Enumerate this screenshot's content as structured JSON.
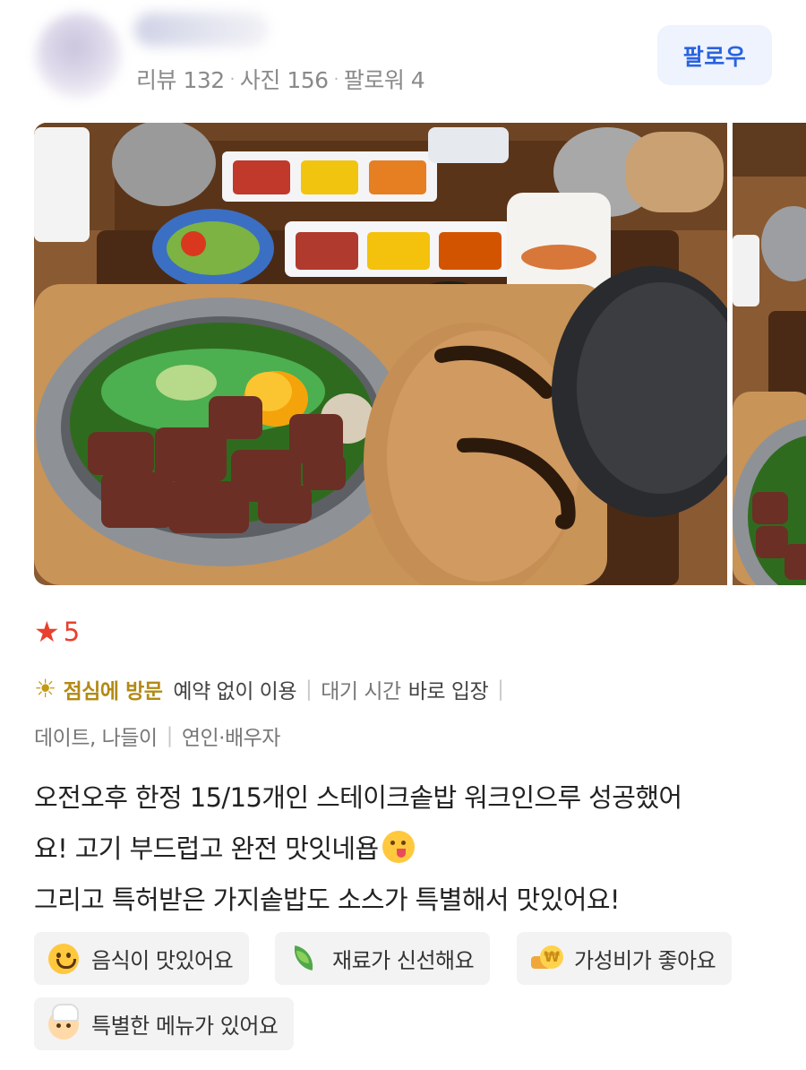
{
  "profile": {
    "stats": {
      "reviews_label": "리뷰 132",
      "photos_label": "사진 156",
      "followers_label": "팔로워 4",
      "separator": "·"
    },
    "follow_label": "팔로우"
  },
  "photos": {
    "count_visible": 2
  },
  "rating": {
    "icon": "star-icon",
    "value": "5",
    "color": "#e8402e"
  },
  "visit": {
    "icon": "sun-icon",
    "time": "점심에 방문",
    "reservation": "예약 없이 이용",
    "wait_label": "대기 시간",
    "wait_value": "바로 입장",
    "purpose": "데이트, 나들이",
    "companion": "연인·배우자",
    "separator": "|"
  },
  "review": {
    "line1": "오전오후 한정 15/15개인 스테이크솥밥 워크인으루 성공했어",
    "line2": "요! 고기 부드럽고 완전 맛잇네욥",
    "line3": "그리고 특허받은 가지솥밥도 소스가 특별해서 맛있어요!"
  },
  "tags": [
    {
      "label": "음식이 맛있어요",
      "icon": "smile-icon"
    },
    {
      "label": "재료가 신선해요",
      "icon": "leaf-icon"
    },
    {
      "label": "가성비가 좋아요",
      "icon": "coin-icon"
    },
    {
      "label": "특별한 메뉴가 있어요",
      "icon": "chef-icon"
    }
  ],
  "colors": {
    "accent_blue": "#2a63e0",
    "visit_gold": "#b28a14",
    "tag_bg": "#f3f3f3"
  }
}
